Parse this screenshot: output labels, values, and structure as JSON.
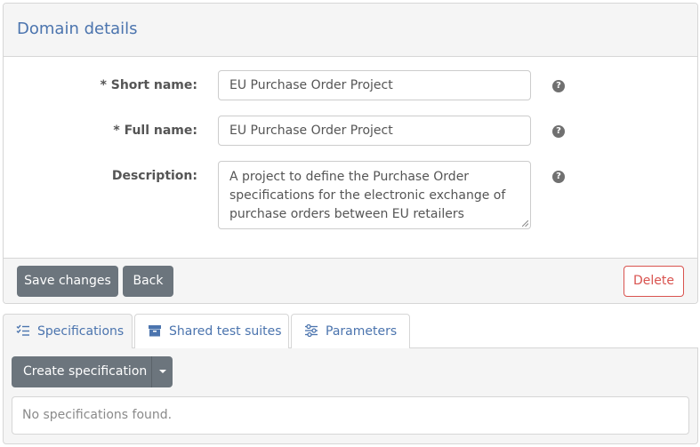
{
  "domain_card": {
    "title": "Domain details",
    "fields": {
      "short_name": {
        "label": "* Short name:",
        "value": "EU Purchase Order Project"
      },
      "full_name": {
        "label": "* Full name:",
        "value": "EU Purchase Order Project"
      },
      "description": {
        "label": "Description:",
        "value": "A project to define the Purchase Order specifications for the electronic exchange of purchase orders between EU retailers"
      }
    },
    "help_glyph": "?",
    "icons": {
      "help": "question-circle-icon"
    },
    "buttons": {
      "save": "Save changes",
      "back": "Back",
      "delete": "Delete"
    }
  },
  "tabs": {
    "items": [
      {
        "label": "Specifications",
        "icon": "list-check-icon",
        "active": true
      },
      {
        "label": "Shared test suites",
        "icon": "archive-box-icon",
        "active": false
      },
      {
        "label": "Parameters",
        "icon": "sliders-icon",
        "active": false
      }
    ],
    "create_button": "Create specification",
    "empty_message": "No specifications found."
  },
  "colors": {
    "accent": "#4b74ae",
    "button_gray": "#6c757d",
    "danger": "#d9534f",
    "panel_bg": "#f5f5f5",
    "border": "#d6d6d6"
  }
}
